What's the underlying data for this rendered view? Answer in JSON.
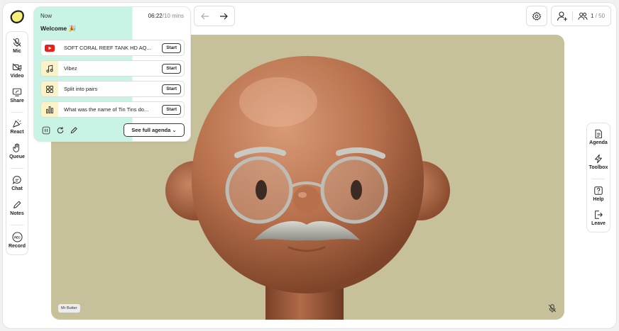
{
  "left_toolbar": {
    "mic": "Mic",
    "video": "Video",
    "share": "Share",
    "react": "React",
    "queue": "Queue",
    "chat": "Chat",
    "notes": "Notes",
    "record": "Record",
    "record_badge": "REC"
  },
  "right_toolbar": {
    "agenda": "Agenda",
    "toolbox": "Toolbox",
    "help": "Help",
    "leave": "Leave"
  },
  "agenda_panel": {
    "now_label": "Now",
    "elapsed": "06:22",
    "total": "/10 mins",
    "title": "Welcome 🎉",
    "items": [
      {
        "label": "SOFT CORAL REEF TANK HD AQ...",
        "button": "Start",
        "icon": "youtube-icon"
      },
      {
        "label": "Vibez",
        "button": "Start",
        "icon": "music-note-icon"
      },
      {
        "label": "Split into pairs",
        "button": "Start",
        "icon": "grid-icon"
      },
      {
        "label": "What was the name of Tin Tins do...",
        "button": "Start",
        "icon": "bar-chart-icon"
      }
    ],
    "see_full_agenda": "See full agenda ⌄"
  },
  "participants": {
    "current": "1",
    "max": " / 50"
  },
  "video": {
    "participant_name": "Mr Butter"
  },
  "colors": {
    "agenda_active": "#c9f3e4",
    "video_bg": "#c6c19b",
    "logo_yellow": "#f6f07a"
  }
}
